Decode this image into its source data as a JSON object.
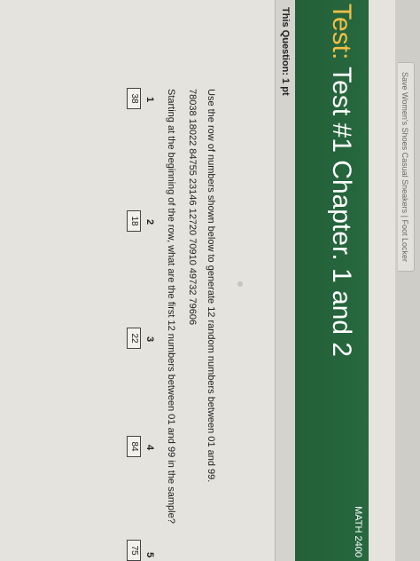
{
  "browser": {
    "tab_title": "Save Women's Shoes Casual Sneakers | Foot Locker"
  },
  "header": {
    "title_prefix": "Test:",
    "title": "Test #1 Chapter. 1 and 2",
    "course": "MATH 2400",
    "background_color": "#27683f",
    "prefix_color": "#f3c048"
  },
  "question": {
    "points_label": "This Question: 1 pt",
    "instruction": "Use the row of numbers shown below to generate 12 random numbers between 01 and 99.",
    "random_row": "78038  18022  84755  23146  12720  70910  49732  79606",
    "prompt": "Starting at the beginning of the row, what are the first 12 numbers between 01 and 99 in the sample?",
    "answers": [
      {
        "number": "1",
        "value": "38"
      },
      {
        "number": "2",
        "value": "18"
      },
      {
        "number": "3",
        "value": "22"
      },
      {
        "number": "4",
        "value": "84"
      },
      {
        "number": "5",
        "value": "75"
      }
    ]
  }
}
